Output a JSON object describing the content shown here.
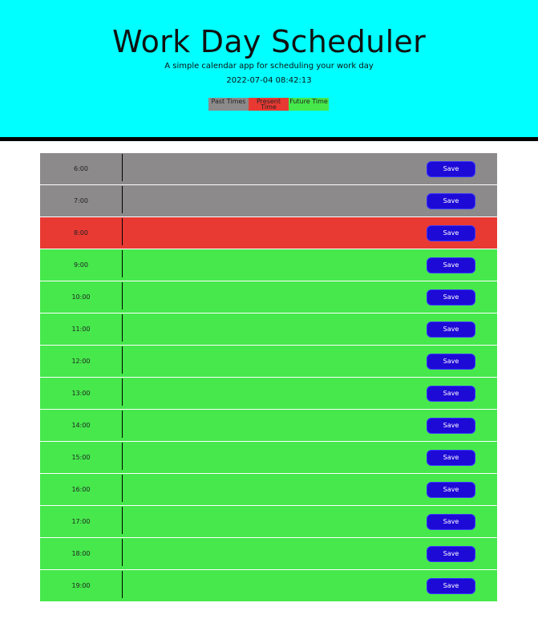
{
  "header": {
    "title": "Work Day Scheduler",
    "subtitle": "A simple calendar app for scheduling your work day",
    "datetime": "2022-07-04 08:42:13"
  },
  "legend": [
    {
      "label": "Past Times",
      "color": "#8c8a8b"
    },
    {
      "label": "Present Time",
      "color": "#e83a33"
    },
    {
      "label": "Future Time",
      "color": "#46e84c"
    }
  ],
  "colors": {
    "header_bg": "#00ffff",
    "past": "#8c8a8b",
    "present": "#e83a33",
    "future": "#46e84c",
    "save_button": "#1e0ad6"
  },
  "rows": [
    {
      "hour": "6:00",
      "status": "past",
      "text": "",
      "save_label": "Save"
    },
    {
      "hour": "7:00",
      "status": "past",
      "text": "",
      "save_label": "Save"
    },
    {
      "hour": "8:00",
      "status": "present",
      "text": "",
      "save_label": "Save"
    },
    {
      "hour": "9:00",
      "status": "future",
      "text": "",
      "save_label": "Save"
    },
    {
      "hour": "10:00",
      "status": "future",
      "text": "",
      "save_label": "Save"
    },
    {
      "hour": "11:00",
      "status": "future",
      "text": "",
      "save_label": "Save"
    },
    {
      "hour": "12:00",
      "status": "future",
      "text": "",
      "save_label": "Save"
    },
    {
      "hour": "13:00",
      "status": "future",
      "text": "",
      "save_label": "Save"
    },
    {
      "hour": "14:00",
      "status": "future",
      "text": "",
      "save_label": "Save"
    },
    {
      "hour": "15:00",
      "status": "future",
      "text": "",
      "save_label": "Save"
    },
    {
      "hour": "16:00",
      "status": "future",
      "text": "",
      "save_label": "Save"
    },
    {
      "hour": "17:00",
      "status": "future",
      "text": "",
      "save_label": "Save"
    },
    {
      "hour": "18:00",
      "status": "future",
      "text": "",
      "save_label": "Save"
    },
    {
      "hour": "19:00",
      "status": "future",
      "text": "",
      "save_label": "Save"
    }
  ]
}
